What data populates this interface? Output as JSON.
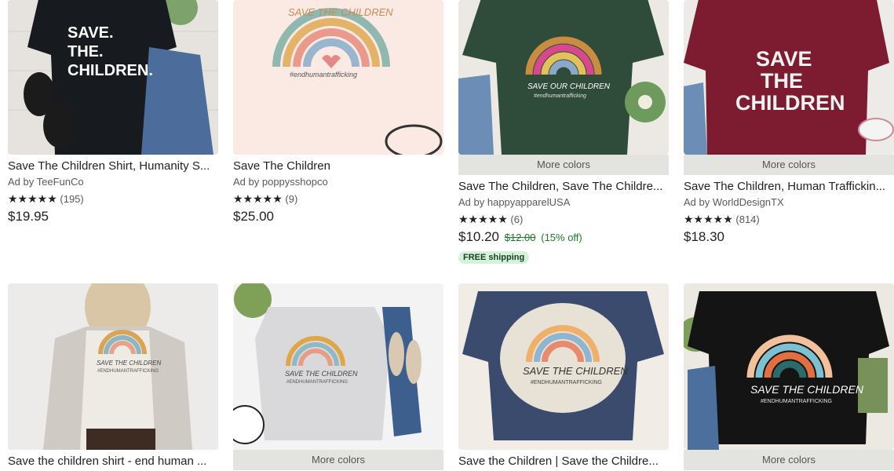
{
  "listings": [
    {
      "title": "Save The Children Shirt, Humanity S...",
      "ad": "Ad by TeeFunCo",
      "stars": "★★★★★",
      "reviews": "(195)",
      "price": "$19.95",
      "shirt_text": [
        "SAVE.",
        "THE.",
        "CHILDREN."
      ],
      "shirt_color": "#171a1e"
    },
    {
      "title": "Save The Children",
      "ad": "Ad by poppysshopco",
      "stars": "★★★★★",
      "reviews": "(9)",
      "price": "$25.00",
      "shirt_text": [
        "SAVE THE CHILDREN",
        "#endhumantrafficking"
      ],
      "shirt_color": "#fbe9e4"
    },
    {
      "title": "Save The Children, Save The Childre...",
      "more_colors": "More colors",
      "ad": "Ad by happyapparelUSA",
      "stars": "★★★★★",
      "reviews": "(6)",
      "price": "$10.20",
      "original_price": "$12.00",
      "discount": "(15% off)",
      "badge": "FREE shipping",
      "shirt_text": [
        "SAVE OUR CHILDREN",
        "#endhumantrafficking"
      ],
      "shirt_color": "#2f4b3a"
    },
    {
      "title": "Save The Children, Human Traffickin...",
      "more_colors": "More colors",
      "ad": "Ad by WorldDesignTX",
      "stars": "★★★★★",
      "reviews": "(814)",
      "price": "$18.30",
      "shirt_text": [
        "SAVE",
        "THE",
        "CHILDREN"
      ],
      "shirt_color": "#7d1c30"
    },
    {
      "title": "Save the children shirt - end human ...",
      "shirt_text": [
        "SAVE THE CHILDREN",
        "#ENDHUMANTRAFFICKING"
      ],
      "shirt_color": "#eeeae4"
    },
    {
      "title": "",
      "more_colors": "More colors",
      "shirt_text": [
        "SAVE THE CHILDREN",
        "#ENDHUMANTRAFFICKING"
      ],
      "shirt_color": "#d9d9db"
    },
    {
      "title": "Save the Children | Save the Childre...",
      "shirt_text": [
        "SAVE THE CHILDREN",
        "#ENDHUMANTRAFFICKING"
      ],
      "shirt_color": "#3a4b6e"
    },
    {
      "title": "",
      "more_colors": "More colors",
      "shirt_text": [
        "SAVE THE CHILDREN",
        "#ENDHUMANTRAFFICKING"
      ],
      "shirt_color": "#141414"
    }
  ],
  "colors": {
    "sale_green": "#1d7a2d",
    "badge_bg": "#d4f1d9",
    "more_colors_bg": "#e3e3df"
  }
}
